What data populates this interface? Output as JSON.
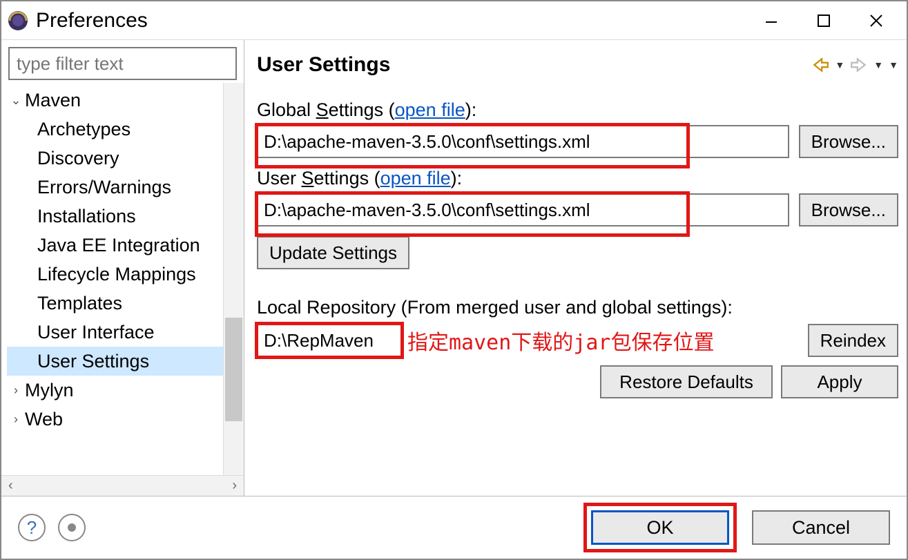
{
  "window": {
    "title": "Preferences"
  },
  "sidebar": {
    "filter_placeholder": "type filter text",
    "items": [
      {
        "label": "Maven",
        "expandable": true,
        "expanded": true,
        "depth": 0
      },
      {
        "label": "Archetypes",
        "depth": 1
      },
      {
        "label": "Discovery",
        "depth": 1
      },
      {
        "label": "Errors/Warnings",
        "depth": 1
      },
      {
        "label": "Installations",
        "depth": 1
      },
      {
        "label": "Java EE Integration",
        "depth": 1
      },
      {
        "label": "Lifecycle Mappings",
        "depth": 1
      },
      {
        "label": "Templates",
        "depth": 1
      },
      {
        "label": "User Interface",
        "depth": 1
      },
      {
        "label": "User Settings",
        "depth": 1,
        "selected": true
      },
      {
        "label": "Mylyn",
        "expandable": true,
        "expanded": false,
        "depth": 0
      },
      {
        "label": "Web",
        "expandable": true,
        "expanded": false,
        "depth": 0
      }
    ]
  },
  "main": {
    "page_title": "User Settings",
    "global_settings_label_pre": "Global ",
    "global_settings_label_u": "S",
    "global_settings_label_post": "ettings (",
    "open_file": "open file",
    "close_paren": "):",
    "user_settings_label_pre": "User ",
    "user_settings_label_u": "S",
    "user_settings_label_post": "ettings (",
    "global_settings_value": "D:\\apache-maven-3.5.0\\conf\\settings.xml",
    "user_settings_value": "D:\\apache-maven-3.5.0\\conf\\settings.xml",
    "browse_label": "Browse...",
    "update_label": "Update Settings",
    "local_repo_label": "Local Repository (From merged user and global settings):",
    "local_repo_value": "D:\\RepMaven",
    "annotation": "指定maven下载的jar包保存位置",
    "reindex_label": "Reindex",
    "restore_defaults": "Restore Defaults",
    "apply": "Apply"
  },
  "footer": {
    "ok": "OK",
    "cancel": "Cancel"
  }
}
